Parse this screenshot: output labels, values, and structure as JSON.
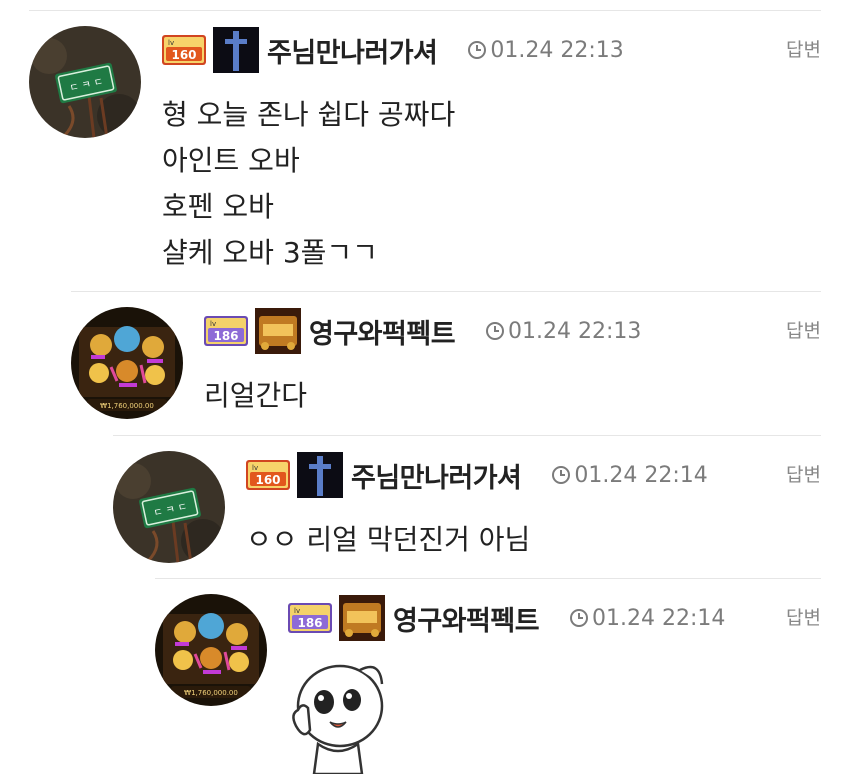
{
  "comments": [
    {
      "level": "160",
      "nickname": "주님만나러가셔",
      "time": "01.24 22:13",
      "reply_label": "답변",
      "avatar_sign": "ㄷ ㅋ ㄷ",
      "lines": [
        "형 오늘 존나 쉽다 공짜다",
        "아인트 오바",
        "호펜 오바",
        "샬케 오바 3폴ㄱㄱ"
      ]
    },
    {
      "level": "186",
      "nickname": "영구와퍽펙트",
      "time": "01.24 22:13",
      "reply_label": "답변",
      "avatar_amount": "₩1,760,000.00",
      "lines": [
        "리얼간다"
      ]
    },
    {
      "level": "160",
      "nickname": "주님만나러가셔",
      "time": "01.24 22:14",
      "reply_label": "답변",
      "avatar_sign": "ㄷ ㅋ ㄷ",
      "lines": [
        "ㅇㅇ 리얼 막던진거 아님"
      ]
    },
    {
      "level": "186",
      "nickname": "영구와퍽펙트",
      "time": "01.24 22:14",
      "reply_label": "답변",
      "avatar_amount": "₩1,760,000.00",
      "lines": []
    }
  ],
  "icons": {
    "clock": "clock-icon",
    "level_badge": "level-badge-icon",
    "emblem": "emblem-icon",
    "sticker": "sticker-image"
  },
  "colors": {
    "text": "#222222",
    "meta": "#7b7b7b",
    "divider": "#e6e6e6"
  }
}
